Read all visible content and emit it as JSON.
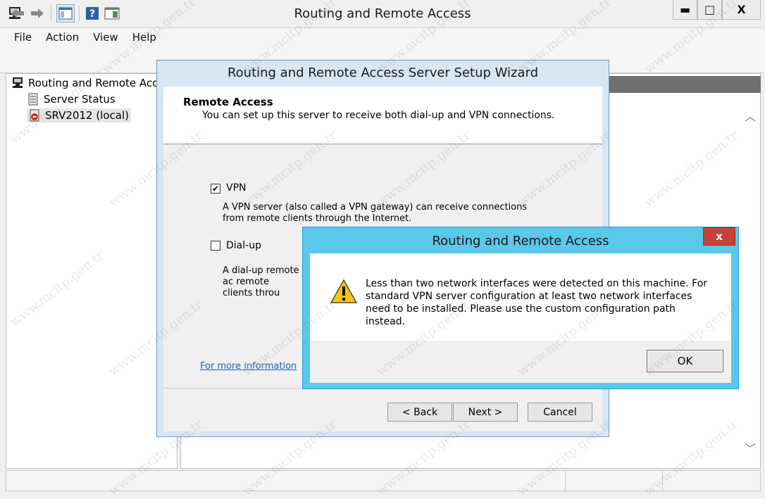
{
  "window": {
    "title": "Routing and Remote Access",
    "min_glyph": "▬",
    "max_glyph": "□",
    "close_glyph": "X"
  },
  "menu": {
    "items": [
      "File",
      "Action",
      "View",
      "Help"
    ]
  },
  "toolbar": {
    "back_icon": "arrow-left-icon",
    "forward_icon": "arrow-right-icon",
    "console_tree_icon": "console-tree-icon",
    "help_icon": "help-icon",
    "action_pane_icon": "action-pane-icon"
  },
  "tree": {
    "root_label": "Routing and Remote Access",
    "items": [
      {
        "label": "Server Status"
      },
      {
        "label": "SRV2012 (local)"
      }
    ]
  },
  "wizard": {
    "title": "Routing and Remote Access Server Setup Wizard",
    "header_title": "Remote Access",
    "header_subtitle": "You can set up this server to receive both dial-up and VPN connections.",
    "options": [
      {
        "label": "VPN",
        "checked": true,
        "description": "A VPN server (also called a VPN gateway) can receive connections from remote clients through the Internet."
      },
      {
        "label": "Dial-up",
        "checked": false,
        "description": "A dial-up remote ac remote clients throu"
      }
    ],
    "more_info_link": "For more information",
    "back_button": "< Back",
    "next_button": "Next >",
    "cancel_button": "Cancel"
  },
  "alert": {
    "title": "Routing and Remote Access",
    "close_glyph": "x",
    "message": "Less than two network interfaces were detected on this machine.  For standard VPN server configuration at least two network interfaces need to be installed. Please use the custom configuration path instead.",
    "icon": "warning-icon",
    "ok_button": "OK"
  },
  "watermark": "www.mcitp.gen.tr",
  "colors": {
    "dialog_frame": "#5ac8ea",
    "close_red": "#c7423a",
    "wizard_frame": "#d6e6f3",
    "link": "#1a5fb4"
  }
}
